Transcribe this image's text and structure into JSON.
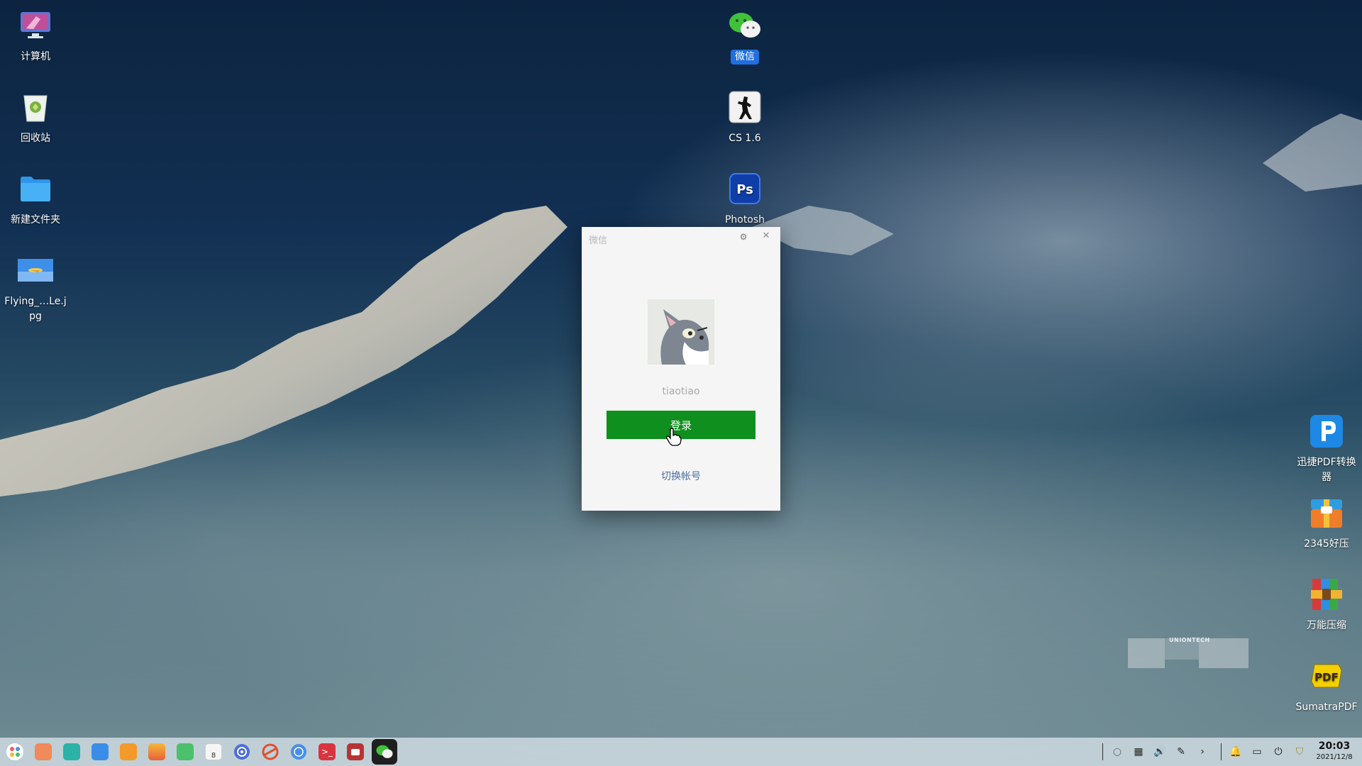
{
  "desktop_left": [
    {
      "name": "computer",
      "label": "计算机",
      "icon": "computer-icon"
    },
    {
      "name": "trash",
      "label": "回收站",
      "icon": "trash-icon"
    },
    {
      "name": "new-folder",
      "label": "新建文件夹",
      "icon": "folder-icon"
    },
    {
      "name": "image-file",
      "label": "Flying_…Le.jpg",
      "icon": "image-icon"
    }
  ],
  "desktop_center": [
    {
      "name": "wechat",
      "label": "微信",
      "icon": "wechat-icon"
    },
    {
      "name": "cs16",
      "label": "CS 1.6",
      "icon": "counter-strike-icon"
    },
    {
      "name": "photoshop",
      "label": "Photosh",
      "icon": "photoshop-icon"
    }
  ],
  "desktop_right": [
    {
      "name": "xunjie-pdf",
      "label": "迅捷PDF转换器",
      "icon": "pdf-converter-icon"
    },
    {
      "name": "haozip",
      "label": "2345好压",
      "icon": "archive-icon"
    },
    {
      "name": "wanneng-zip",
      "label": "万能压缩",
      "icon": "archive-icon"
    },
    {
      "name": "sumatra",
      "label": "SumatraPDF",
      "icon": "sumatra-pdf-icon"
    }
  ],
  "dialog": {
    "title": "微信",
    "username": "tiaotiao",
    "login_label": "登录",
    "switch_label": "切换帐号"
  },
  "watermark": {
    "text": "UNIONTECH"
  },
  "taskbar": {
    "apps": [
      {
        "name": "launcher",
        "color": "#ffffff"
      },
      {
        "name": "multitask",
        "color": "#f08a5a"
      },
      {
        "name": "file-manager",
        "color": "#2bb3a8"
      },
      {
        "name": "app-store",
        "color": "#3b8ee8"
      },
      {
        "name": "calendar-grid",
        "color": "#f39a2b"
      },
      {
        "name": "image-viewer",
        "color": "#e8603a"
      },
      {
        "name": "music",
        "color": "#4cc06b"
      },
      {
        "name": "calendar",
        "color": "#f5f5f5"
      },
      {
        "name": "settings",
        "color": "#4a6ed6"
      },
      {
        "name": "browser",
        "color": "#e0502f"
      },
      {
        "name": "network",
        "color": "#4b8ee6"
      },
      {
        "name": "terminal",
        "color": "#d9343f"
      },
      {
        "name": "screen-recorder",
        "color": "#d14040"
      },
      {
        "name": "wechat",
        "color": "#222222"
      }
    ],
    "calendar_day": "8",
    "time": "20:03",
    "date": "2021/12/8"
  }
}
